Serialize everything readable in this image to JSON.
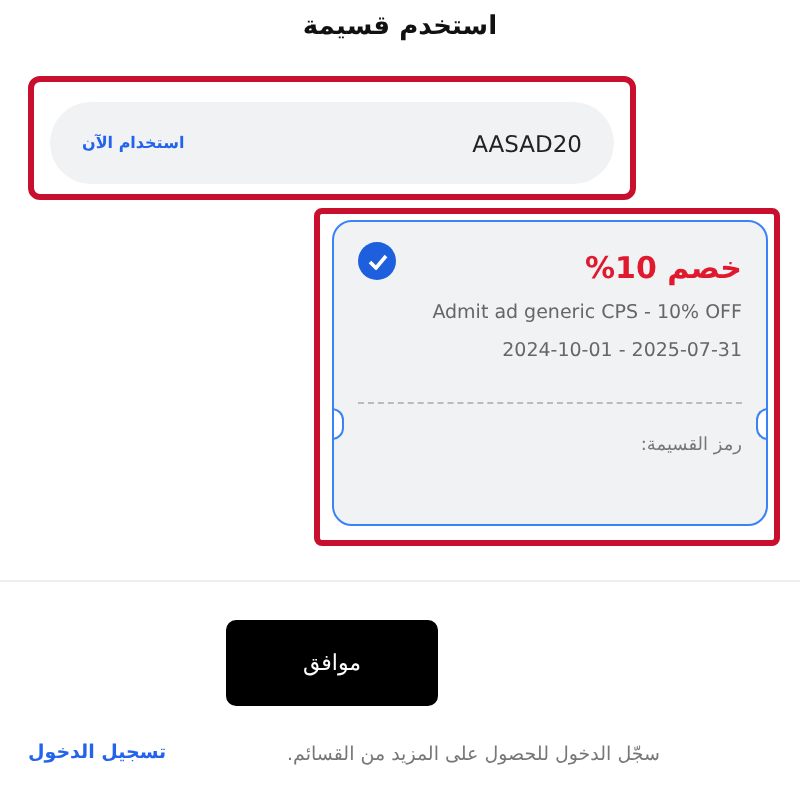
{
  "title": "استخدم قسيمة",
  "code_field": {
    "value": "AASAD20",
    "apply_label": "استخدام الآن"
  },
  "coupons": [
    {
      "selected": true,
      "discount": "خصم 10%",
      "description": "Admit ad generic CPS - 10% OFF",
      "validity": "2024-10-01 - 2025-07-31",
      "code_label": "رمز القسيمة:"
    }
  ],
  "ok_button": "موافق",
  "login_prompt": {
    "text": "سجّل الدخول للحصول على المزيد من القسائم.",
    "link": "تسجيل الدخول"
  }
}
